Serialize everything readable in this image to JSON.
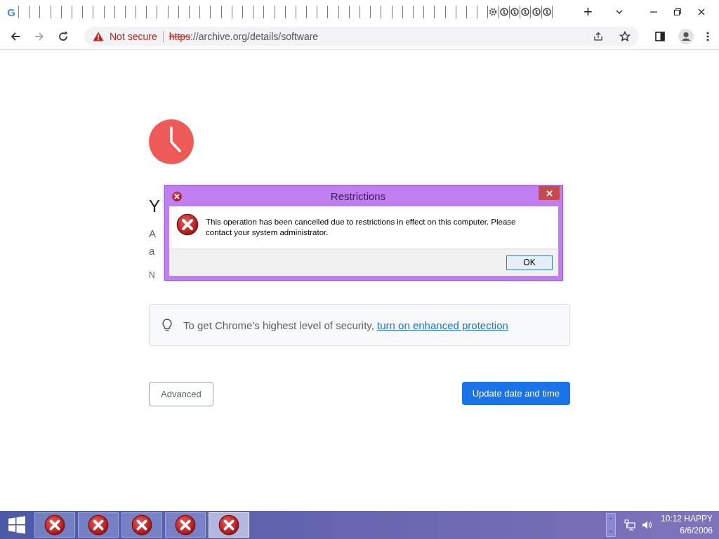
{
  "browser": {
    "tabs": [
      {
        "kind": "google",
        "label": "G"
      },
      {
        "kind": "blank"
      },
      {
        "kind": "blank"
      },
      {
        "kind": "blank"
      },
      {
        "kind": "blank"
      },
      {
        "kind": "blank"
      },
      {
        "kind": "blank"
      },
      {
        "kind": "blank"
      },
      {
        "kind": "blank"
      },
      {
        "kind": "blank"
      },
      {
        "kind": "blank"
      },
      {
        "kind": "blank"
      },
      {
        "kind": "blank"
      },
      {
        "kind": "blank"
      },
      {
        "kind": "blank"
      },
      {
        "kind": "blank"
      },
      {
        "kind": "blank"
      },
      {
        "kind": "blank"
      },
      {
        "kind": "blank"
      },
      {
        "kind": "blank"
      },
      {
        "kind": "blank"
      },
      {
        "kind": "blank"
      },
      {
        "kind": "blank"
      },
      {
        "kind": "blank"
      },
      {
        "kind": "blank"
      },
      {
        "kind": "blank"
      },
      {
        "kind": "blank"
      },
      {
        "kind": "blank"
      },
      {
        "kind": "blank"
      },
      {
        "kind": "blank"
      },
      {
        "kind": "blank"
      },
      {
        "kind": "blank"
      },
      {
        "kind": "blank"
      },
      {
        "kind": "blank"
      },
      {
        "kind": "blank"
      },
      {
        "kind": "blank"
      },
      {
        "kind": "blank"
      },
      {
        "kind": "blank"
      },
      {
        "kind": "blank"
      },
      {
        "kind": "blank"
      },
      {
        "kind": "blank"
      },
      {
        "kind": "blank"
      },
      {
        "kind": "blank"
      },
      {
        "kind": "blank"
      },
      {
        "kind": "blank"
      },
      {
        "kind": "gear"
      },
      {
        "kind": "globe"
      },
      {
        "kind": "globe"
      },
      {
        "kind": "globe"
      },
      {
        "kind": "globe"
      },
      {
        "kind": "globe"
      }
    ],
    "new_tab": "+",
    "security": "Not secure",
    "url_scheme": "https",
    "url_rest": "://archive.org/details/software"
  },
  "page": {
    "heading": "Y",
    "paragraph_lines": [
      "A",
      "a"
    ],
    "error_code": "N",
    "tip_text": "To get Chrome's highest level of security, ",
    "tip_link": "turn on enhanced protection",
    "advanced_button": "Advanced",
    "primary_button": "Update date and time"
  },
  "dialog": {
    "title": "Restrictions",
    "message": "This operation has been cancelled due to restrictions in effect on this computer. Please contact your system administrator.",
    "ok_button": "OK"
  },
  "taskbar": {
    "items": [
      {
        "selected": false
      },
      {
        "selected": false
      },
      {
        "selected": false
      },
      {
        "selected": false
      },
      {
        "selected": true
      }
    ],
    "clock_time": "10:12 HAPPY",
    "clock_date": "6/6/2006"
  }
}
